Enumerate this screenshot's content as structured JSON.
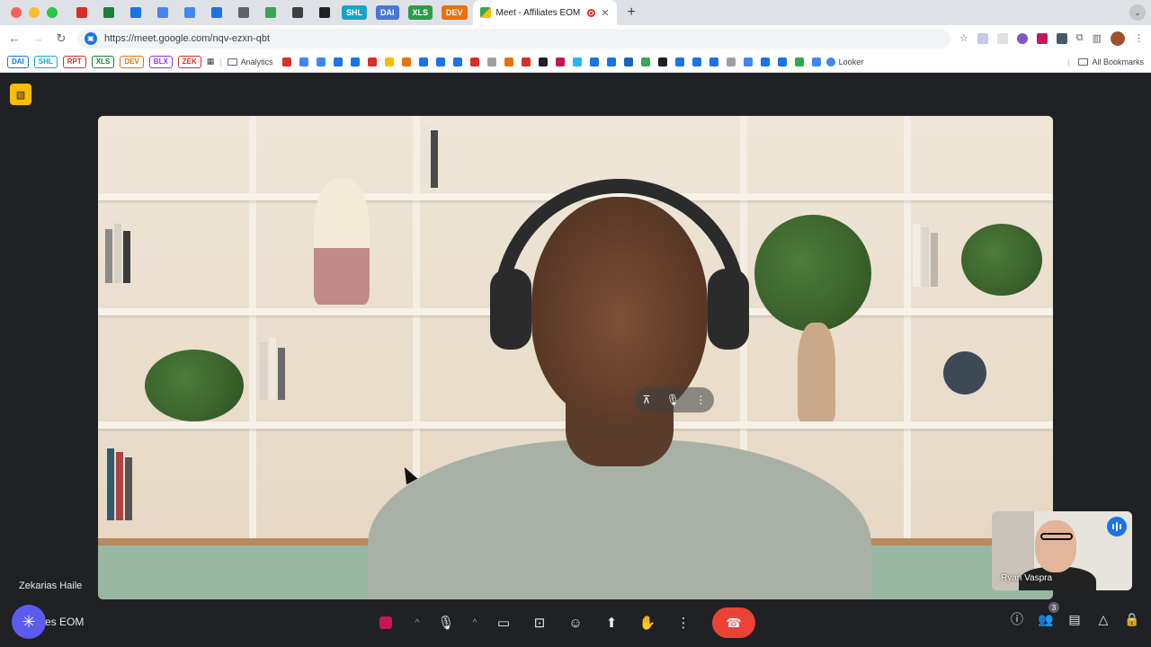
{
  "browser": {
    "pinned_tabs": [
      {
        "name": "gmail",
        "color": "#d93025"
      },
      {
        "name": "sheets",
        "color": "#188038"
      },
      {
        "name": "star",
        "color": "#1a73e8"
      },
      {
        "name": "looker",
        "color": "#4285f4"
      },
      {
        "name": "looker-2",
        "color": "#4285f4"
      },
      {
        "name": "dashboard",
        "color": "#1a73e8"
      },
      {
        "name": "docs",
        "color": "#5f6368"
      },
      {
        "name": "drive",
        "color": "#34a853"
      },
      {
        "name": "cloud",
        "color": "#3c4043"
      },
      {
        "name": "notion",
        "color": "#202124"
      }
    ],
    "label_tabs": [
      {
        "text": "SHL",
        "color": "#1aa3c9"
      },
      {
        "text": "DAI",
        "color": "#4a76d4"
      },
      {
        "text": "XLS",
        "color": "#2e9b4a"
      },
      {
        "text": "DEV",
        "color": "#e8710a"
      }
    ],
    "active_tab": {
      "title": "Meet - Affiliates EOM"
    },
    "new_tab": "+",
    "url": "https://meet.google.com/nqv-ezxn-qbt",
    "bookmarks": {
      "chips": [
        "DAI",
        "SHL",
        "RPT",
        "XLS",
        "DEV",
        "BLX",
        "ZEK"
      ],
      "chip_colors": [
        "#1a73e8",
        "#1aa3c9",
        "#d93025",
        "#188038",
        "#e8710a",
        "#9334e6",
        "#d93025"
      ],
      "analytics": "Analytics",
      "looker": "Looker",
      "all_bookmarks": "All Bookmarks"
    }
  },
  "meet": {
    "participant_main": "Zekarias Haile",
    "participant_self": "Ryan Vaspra",
    "meeting_name": "es EOM",
    "people_count": "3",
    "colors": {
      "leave": "#ea4335",
      "speaking": "#1a73e8",
      "notice": "#fbbc04"
    }
  }
}
